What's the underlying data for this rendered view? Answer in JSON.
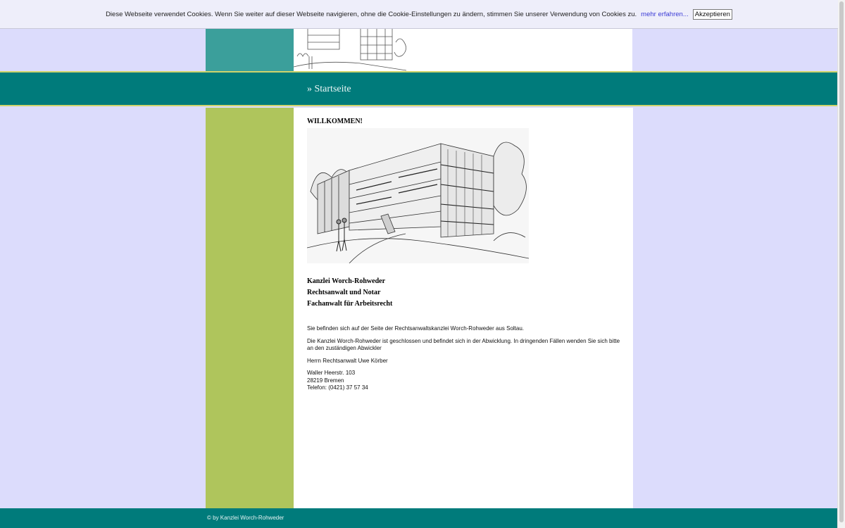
{
  "cookie_bar": {
    "message": "Diese Webseite verwendet Cookies. Wenn Sie weiter auf dieser Webseite navigieren, ohne die Cookie-Einstellungen zu ändern, stimmen Sie unserer Verwendung von Cookies zu.",
    "more_link": "mehr erfahren...",
    "accept_button": "Akzeptieren"
  },
  "nav": {
    "current": "» Startseite"
  },
  "main": {
    "heading": "WILLKOMMEN!",
    "firm_lines": [
      "Kanzlei Worch-Rohweder",
      "Rechtsanwalt und Notar",
      "Fachanwalt für Arbeitsrecht"
    ],
    "paragraphs": [
      "Sie befinden sich auf der Seite der Rechtsanwaltskanzlei Worch-Rohweder aus Soltau.",
      "Die Kanzlei Worch-Rohweder ist geschlossen und befindet sich in der Abwicklung. In dringenden Fällen wenden Sie sich bitte an den zuständigen Abwickler",
      "Herrn Rechtsanwalt Uwe Körber"
    ],
    "address": {
      "street": "Waller Heerstr. 103",
      "city": "28219 Bremen",
      "phone": "Telefon: (0421) 37 57 34"
    }
  },
  "footer": {
    "copyright": "© by Kanzlei Worch-Rohweder"
  },
  "colors": {
    "page_bg": "#dcdcfc",
    "teal": "#007b7b",
    "header_teal": "#3b9f9b",
    "sidebar_green": "#afc55c",
    "nav_border": "#cfd46b"
  },
  "icons": {
    "building_illustration": "building-illustration-icon"
  }
}
